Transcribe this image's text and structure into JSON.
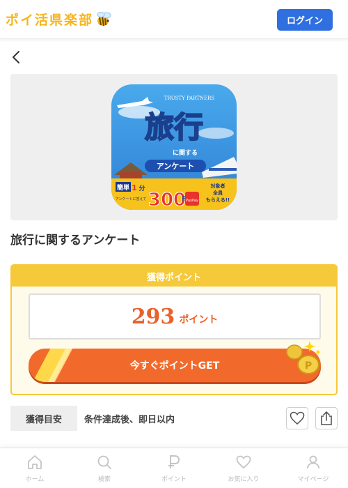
{
  "header": {
    "logo_text": "ポイ活県楽部",
    "login_label": "ログイン"
  },
  "survey": {
    "title": "旅行に関するアンケート",
    "banner": {
      "brand": "TRUSTY PARTNERS",
      "headline": "旅行",
      "sub": "に関する",
      "pill": "アンケート",
      "time_prefix": "簡単",
      "time_value": "1",
      "time_unit": "分",
      "answer_note": "アンケートに答えて",
      "yen_value": "300",
      "yen_unit": "円分",
      "payout": "PayPay",
      "target_line1": "対象者",
      "target_line2": "全員",
      "target_line3": "もらえる!!"
    }
  },
  "points": {
    "header": "獲得ポイント",
    "value": "293",
    "unit": "ポイント",
    "get_label": "今すぐポイントGET"
  },
  "guide": {
    "label": "獲得目安",
    "text": "条件達成後、即日以内"
  },
  "tabs": [
    {
      "label": "ホーム",
      "icon": "home-icon"
    },
    {
      "label": "検索",
      "icon": "search-icon"
    },
    {
      "label": "ポイント",
      "icon": "points-icon"
    },
    {
      "label": "お気に入り",
      "icon": "heart-icon"
    },
    {
      "label": "マイページ",
      "icon": "user-icon"
    }
  ],
  "colors": {
    "accent": "#2f6fe0",
    "logo": "#f7b51c",
    "points": "#e8622a",
    "card_border": "#f5c93a",
    "get_button": "#f26a2b"
  }
}
